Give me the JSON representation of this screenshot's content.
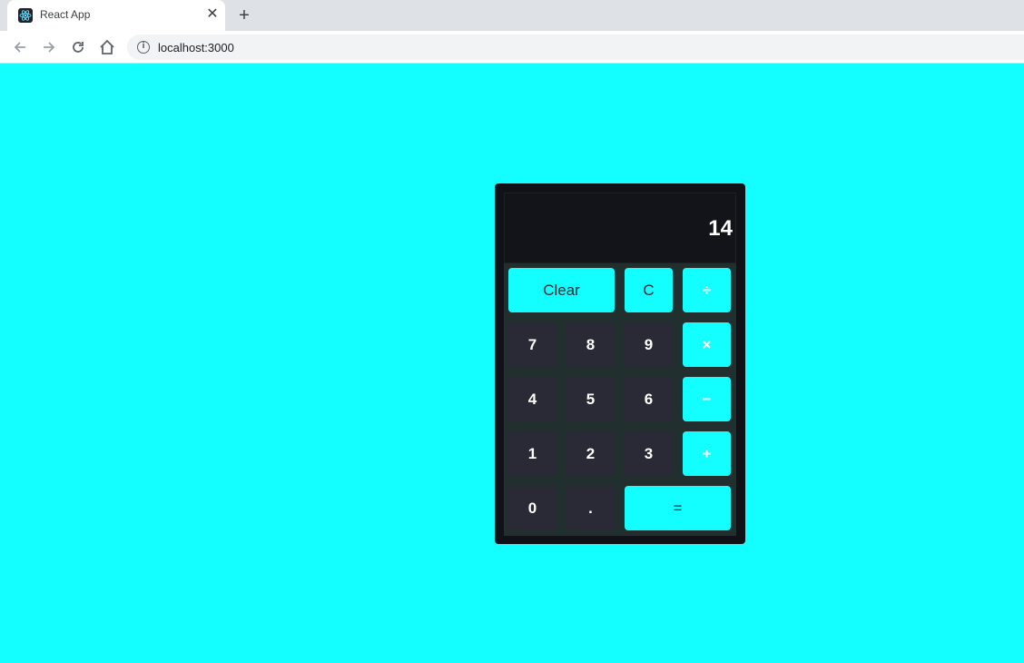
{
  "browser": {
    "tab_title": "React App",
    "tab_close": "✕",
    "new_tab": "+",
    "url": "localhost:3000"
  },
  "calculator": {
    "display": "14",
    "keys": {
      "clear": "Clear",
      "c": "C",
      "divide": "÷",
      "seven": "7",
      "eight": "8",
      "nine": "9",
      "multiply": "×",
      "four": "4",
      "five": "5",
      "six": "6",
      "minus": "−",
      "one": "1",
      "two": "2",
      "three": "3",
      "plus": "+",
      "zero": "0",
      "dot": ".",
      "equals": "="
    }
  },
  "colors": {
    "page_background": "#13ffff",
    "calculator_frame": "#111217",
    "number_key": "#292a35",
    "accent_key": "#13ffff"
  }
}
